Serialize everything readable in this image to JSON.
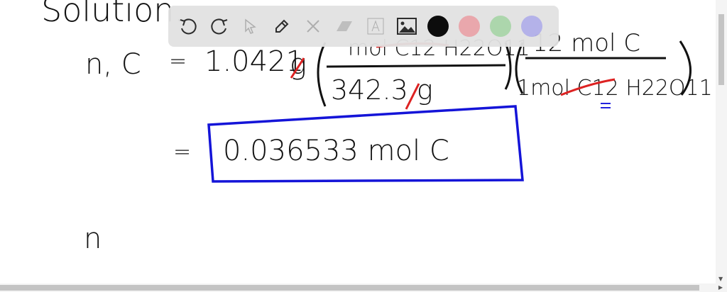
{
  "board": {
    "heading": "Solution.",
    "line1_lhs": "n, C",
    "eq": "=",
    "mass": "1.0421",
    "unit_g": "g",
    "frac1_num": "mol C12 H22O11",
    "frac1_den": "342.3 g",
    "frac2_num": "12 mol C",
    "frac2_den": "1mol C12 H22O11",
    "result": "0.036533 mol C",
    "line3": "n"
  },
  "toolbar": {
    "tools": [
      "undo-icon",
      "redo-icon",
      "select-icon",
      "pen-icon",
      "tools-icon",
      "eraser-icon",
      "text-icon",
      "image-icon"
    ],
    "colors": [
      "#000000",
      "#e8a3a8",
      "#a8d4a8",
      "#b0aee8"
    ]
  }
}
